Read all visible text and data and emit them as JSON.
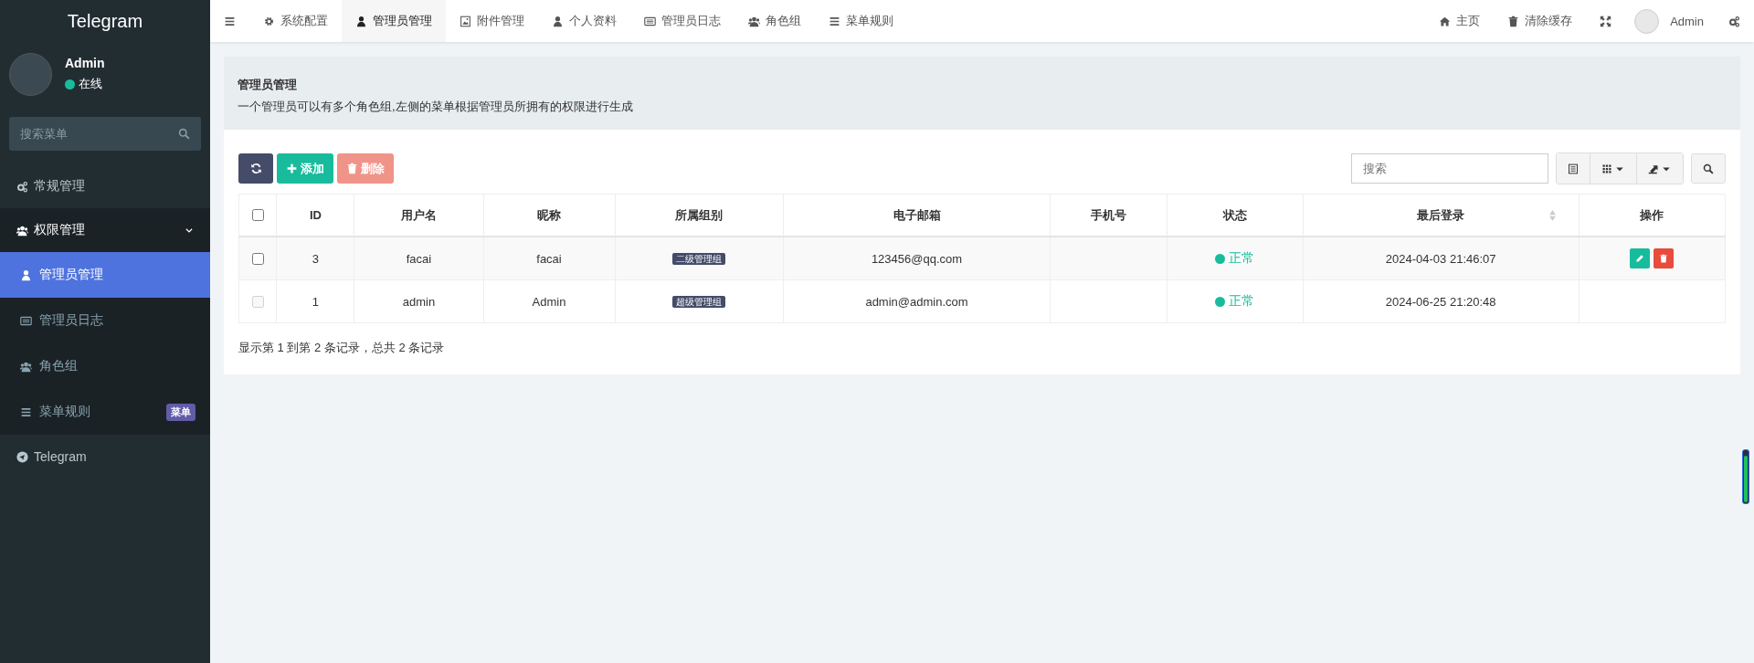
{
  "sidebar": {
    "logo": "Telegram",
    "user": {
      "name": "Admin",
      "status": "在线",
      "online": true
    },
    "search": {
      "placeholder": "搜索菜单"
    },
    "menu": [
      {
        "label": "常规管理",
        "expanded": false
      },
      {
        "label": "权限管理",
        "expanded": true,
        "children": [
          {
            "label": "管理员管理",
            "selected": true
          },
          {
            "label": "管理员日志",
            "selected": false
          },
          {
            "label": "角色组",
            "selected": false
          },
          {
            "label": "菜单规则",
            "selected": false,
            "badge": "菜单"
          }
        ]
      },
      {
        "label": "Telegram",
        "expanded": false
      }
    ]
  },
  "topnav": {
    "tabs": [
      {
        "label": "系统配置",
        "selected": false
      },
      {
        "label": "管理员管理",
        "selected": true
      },
      {
        "label": "附件管理",
        "selected": false
      },
      {
        "label": "个人资料",
        "selected": false
      },
      {
        "label": "管理员日志",
        "selected": false
      },
      {
        "label": "角色组",
        "selected": false
      },
      {
        "label": "菜单规则",
        "selected": false
      }
    ],
    "right": {
      "home": "主页",
      "clear_cache": "清除缓存",
      "user": "Admin"
    }
  },
  "panel": {
    "title": "管理员管理",
    "description": "一个管理员可以有多个角色组,左侧的菜单根据管理员所拥有的权限进行生成"
  },
  "toolbar": {
    "add": "添加",
    "delete": {
      "label": "删除",
      "disabled": true
    },
    "search": {
      "placeholder": "搜索"
    }
  },
  "table": {
    "columns": [
      {
        "label": "ID",
        "sortable": false
      },
      {
        "label": "用户名",
        "sortable": false
      },
      {
        "label": "昵称",
        "sortable": false
      },
      {
        "label": "所属组别",
        "sortable": false
      },
      {
        "label": "电子邮箱",
        "sortable": false
      },
      {
        "label": "手机号",
        "sortable": false
      },
      {
        "label": "状态",
        "sortable": false
      },
      {
        "label": "最后登录",
        "sortable": true
      },
      {
        "label": "操作",
        "sortable": false
      }
    ],
    "header_checked": false,
    "rows": [
      {
        "checked": false,
        "disabled": false,
        "id": "3",
        "username": "facai",
        "nickname": "facai",
        "group": "二级管理组",
        "email": "123456@qq.com",
        "status": "正常",
        "last_login": "2024-04-03 21:46:07",
        "actions": true
      },
      {
        "checked": false,
        "disabled": true,
        "id": "1",
        "username": "admin",
        "nickname": "Admin",
        "group": "超级管理组",
        "email": "admin@admin.com",
        "status": "正常",
        "last_login": "2024-06-25 21:20:48",
        "actions": false
      }
    ]
  },
  "footer": "显示第 1 到第 2 条记录，总共 2 条记录"
}
